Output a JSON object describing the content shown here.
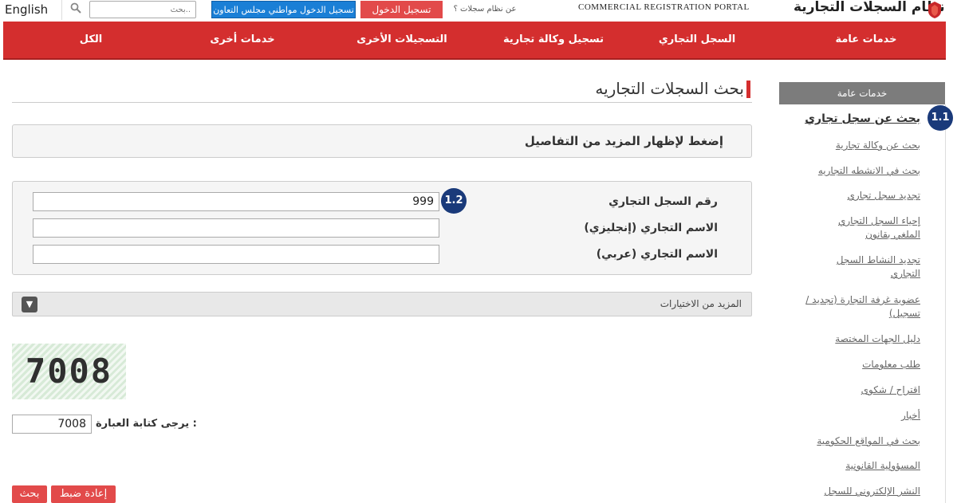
{
  "topbar": {
    "language_link": "English",
    "search_placeholder": "بحث..",
    "gcc_login": "تسجيل الدخول مواطني مجلس التعاون",
    "login": "تسجيل الدخول",
    "about_link": "عن نظام سجلات ؟",
    "portal_title_en": "COMMERCIAL REGISTRATION PORTAL",
    "portal_title_ar": "نظام السجلات التجارية",
    "icons": {
      "search": "search-icon",
      "logo": "emblem-logo"
    }
  },
  "nav": {
    "items": [
      "خدمات عامة",
      "السجل التجاري",
      "تسجيل وكالة تجارية",
      "التسجيلات الأخرى",
      "خدمات أخرى",
      "الكل"
    ]
  },
  "sidebar": {
    "header": "خدمات عامة",
    "items": [
      "بحث عن سجل تجاري",
      "بحث عن وكالة تجارية",
      "بحث في الانشطه التجاريه",
      "تجديد سجل تجاري",
      "إحياء السجل التجاري الملغي بقانون",
      "تجديد النشاط السجل التجاري",
      "عضوية غرفة التجارة (تجديد / تسجيل)",
      "دليل الجهات المختصة",
      "طلب معلومات",
      "اقتراح / شكوى",
      "أخبار",
      "بحث في المواقع الحكومية",
      "المسؤولية القانونية",
      "النشر الإلكتروني للسجل"
    ]
  },
  "badges": {
    "first": "1.1",
    "second": "1.2"
  },
  "main": {
    "page_title": "بحث السجلات التجاريه",
    "expand_text": "إضغط لإظهار المزيد من التفاصيل",
    "fields": [
      {
        "label": "رقم السجل التجاري",
        "value": "999"
      },
      {
        "label": "الاسم التجاري (إنجليزي)",
        "value": ""
      },
      {
        "label": "الاسم التجاري (عربي)",
        "value": ""
      }
    ],
    "more_options": "المزيد من الاختيارات",
    "captcha_image_text": "7008",
    "captcha_label": "يرجى كتابة العبارة :",
    "captcha_value": "7008",
    "buttons": {
      "reset": "إعادة ضبط",
      "search": "بحث"
    }
  },
  "colors": {
    "nav_red": "#d42e2e",
    "button_red": "#e24a4a",
    "gcc_blue": "#1a7fd6",
    "badge_navy": "#1a3a7a"
  }
}
